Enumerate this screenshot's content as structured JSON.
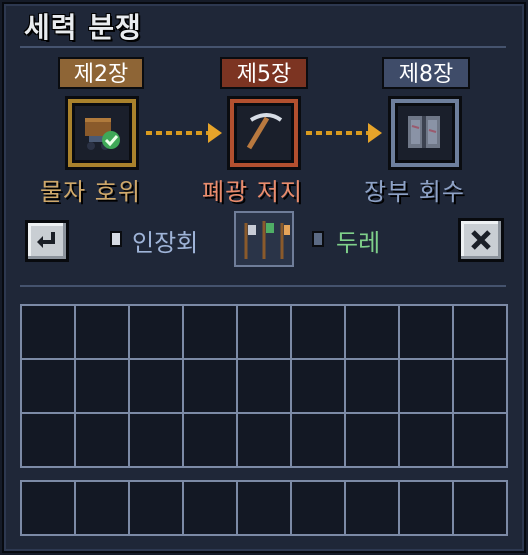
{
  "title": "세력 분쟁",
  "stages": [
    {
      "badge": "제2장",
      "label": "물자 호위",
      "icon": "treasure-cart-check-icon",
      "frame_color": "#a9822c",
      "badge_bg": "#8e6536",
      "label_color": "#cfa86a"
    },
    {
      "badge": "제5장",
      "label": "폐광 저지",
      "icon": "pickaxe-icon",
      "frame_color": "#b3502f",
      "badge_bg": "#7c3422",
      "label_color": "#e98c6d"
    },
    {
      "badge": "제8장",
      "label": "장부 회수",
      "icon": "ledger-book-icon",
      "frame_color": "#6e7f9c",
      "badge_bg": "#3f4c69",
      "label_color": "#8ea2c6"
    }
  ],
  "controls": {
    "back_icon": "return-arrow-icon",
    "close_icon": "close-x-icon",
    "tab_left": "인장회",
    "tab_left_color": "#9fb4d8",
    "tab_right": "두레",
    "tab_right_color": "#7fd08a",
    "center_icon": "faction-banners-icon"
  },
  "grid": {
    "rows": 3,
    "cols": 9
  },
  "bar": {
    "rows": 1,
    "cols": 9
  }
}
